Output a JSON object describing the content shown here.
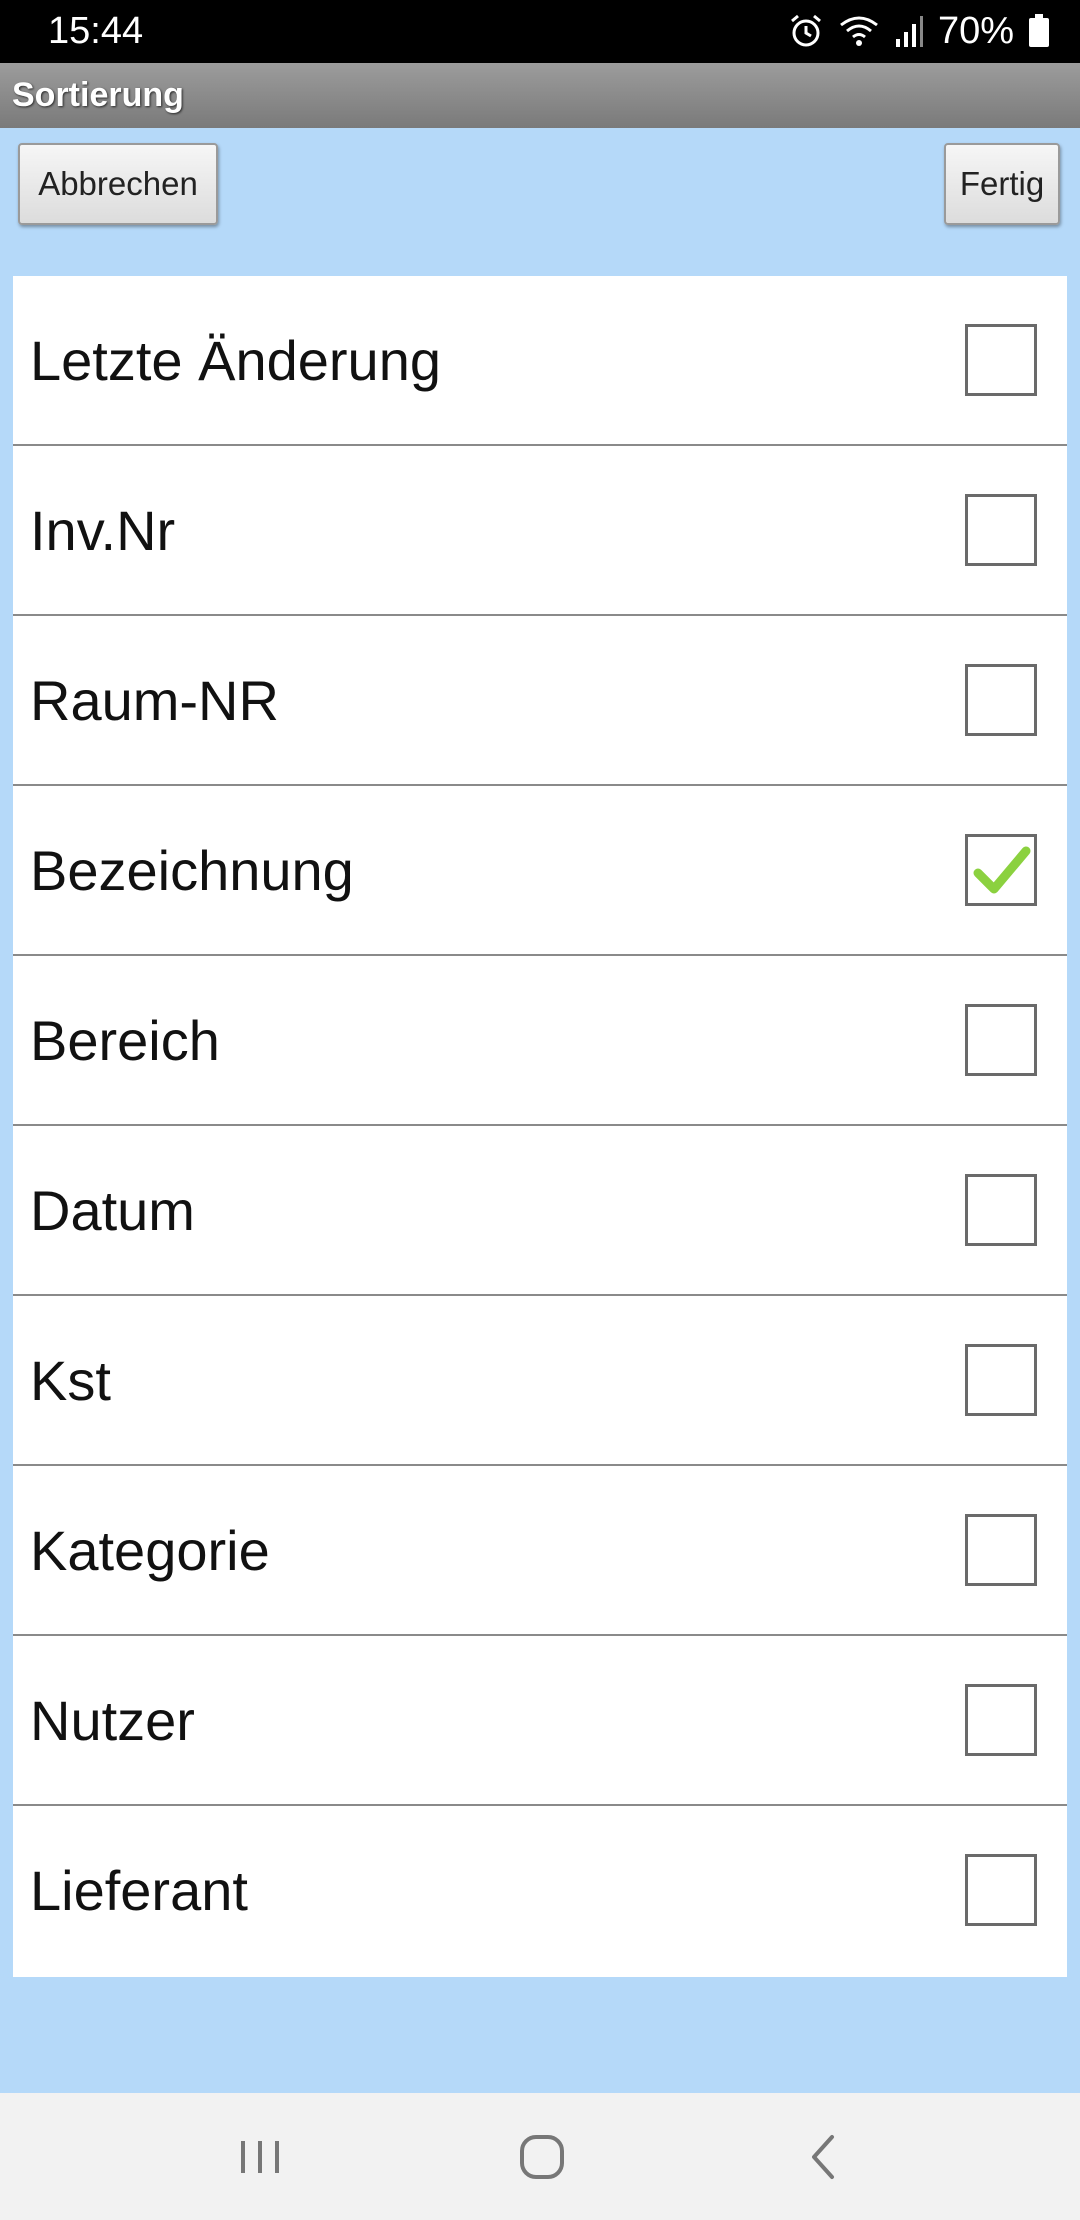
{
  "status_bar": {
    "time": "15:44",
    "battery_percent": "70%",
    "icons": [
      "alarm-icon",
      "wifi-icon",
      "signal-icon",
      "battery-icon"
    ]
  },
  "title_bar": {
    "title": "Sortierung"
  },
  "toolbar": {
    "cancel_label": "Abbrechen",
    "done_label": "Fertig"
  },
  "sort_options": [
    {
      "label": "Letzte Änderung",
      "checked": false
    },
    {
      "label": "Inv.Nr",
      "checked": false
    },
    {
      "label": "Raum-NR",
      "checked": false
    },
    {
      "label": "Bezeichnung",
      "checked": true
    },
    {
      "label": "Bereich",
      "checked": false
    },
    {
      "label": "Datum",
      "checked": false
    },
    {
      "label": "Kst",
      "checked": false
    },
    {
      "label": "Kategorie",
      "checked": false
    },
    {
      "label": "Nutzer",
      "checked": false
    },
    {
      "label": "Lieferant",
      "checked": false
    }
  ],
  "nav_bar": {
    "buttons": [
      "recent-apps-icon",
      "home-icon",
      "back-icon"
    ]
  },
  "colors": {
    "background": "#b5d9f9",
    "title_bar": "#8a8a8a",
    "check_mark": "#8bd13f",
    "status_bar": "#000000"
  }
}
